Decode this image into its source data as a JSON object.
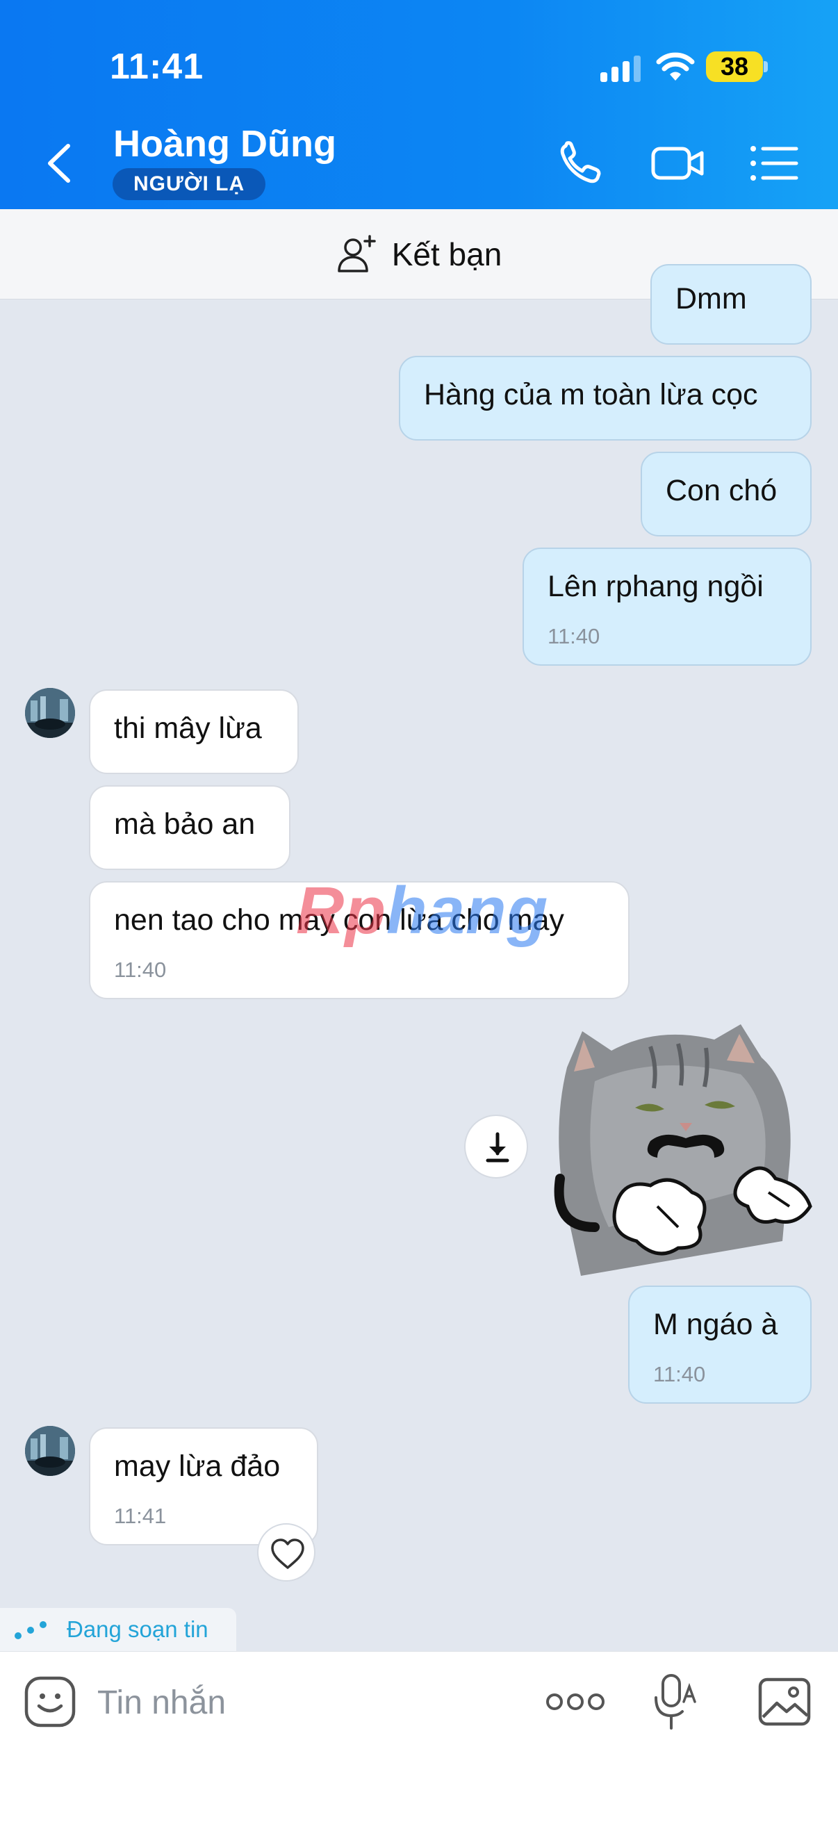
{
  "status": {
    "time": "11:41",
    "battery": "38"
  },
  "header": {
    "name": "Hoàng Dũng",
    "badge": "NGƯỜI LẠ"
  },
  "friend_bar": {
    "label": "Kết bạn"
  },
  "messages": [
    {
      "from": "me",
      "text": "Dmm"
    },
    {
      "from": "me",
      "text": "Hàng của m toàn lừa cọc"
    },
    {
      "from": "me",
      "text": "Con chó"
    },
    {
      "from": "me",
      "text": "Lên rphang ngồi",
      "time": "11:40"
    },
    {
      "from": "them",
      "text": "thi mây lừa"
    },
    {
      "from": "them",
      "text": "mà bảo an"
    },
    {
      "from": "them",
      "text": "nen tao cho may con lừa cho may",
      "time": "11:40"
    },
    {
      "from": "me",
      "type": "sticker",
      "icon": "cat-mustache-sticker"
    },
    {
      "from": "me",
      "text": "M ngáo à",
      "time": "11:40"
    },
    {
      "from": "them",
      "text": "may lừa đảo",
      "time": "11:41"
    }
  ],
  "watermark": {
    "part1": "Rp",
    "part2": "hang"
  },
  "typing": {
    "text": "Đang soạn tin"
  },
  "composer": {
    "placeholder": "Tin nhắn"
  },
  "colors": {
    "header_gradient_start": "#0a78f2",
    "header_gradient_end": "#16a2f6",
    "my_bubble": "#d5eefd",
    "their_bubble": "#ffffff",
    "chat_background": "#e2e7ef",
    "typing_text": "#23a4d8",
    "battery": "#f7e024"
  }
}
